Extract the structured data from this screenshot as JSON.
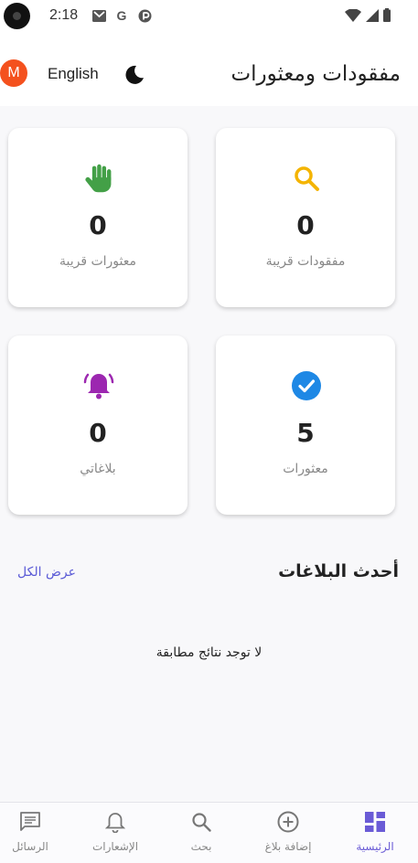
{
  "status_bar": {
    "time": "2:18"
  },
  "app_bar": {
    "avatar_letter": "M",
    "language_toggle": "English",
    "title": "مفقودات ومعثورات"
  },
  "stats": {
    "nearby_lost": {
      "value": "0",
      "label": "مفقودات قريبة"
    },
    "nearby_found": {
      "value": "0",
      "label": "معثورات قريبة"
    },
    "found": {
      "value": "5",
      "label": "معثورات"
    },
    "my_reports": {
      "value": "0",
      "label": "بلاغاتي"
    }
  },
  "recent": {
    "title": "أحدث البلاغات",
    "view_all": "عرض الكل",
    "empty_message": "لا توجد نتائج مطابقة"
  },
  "nav": {
    "home": "الرئيسية",
    "add_report": "إضافة بلاغ",
    "search": "بحث",
    "notifications": "الإشعارات",
    "messages": "الرسائل"
  },
  "colors": {
    "accent": "#6a5bd6",
    "avatar": "#f4511e",
    "search_icon": "#f4b400",
    "hand_icon": "#43a047",
    "check_icon": "#1e88e5",
    "bell_icon": "#9c27b0"
  }
}
